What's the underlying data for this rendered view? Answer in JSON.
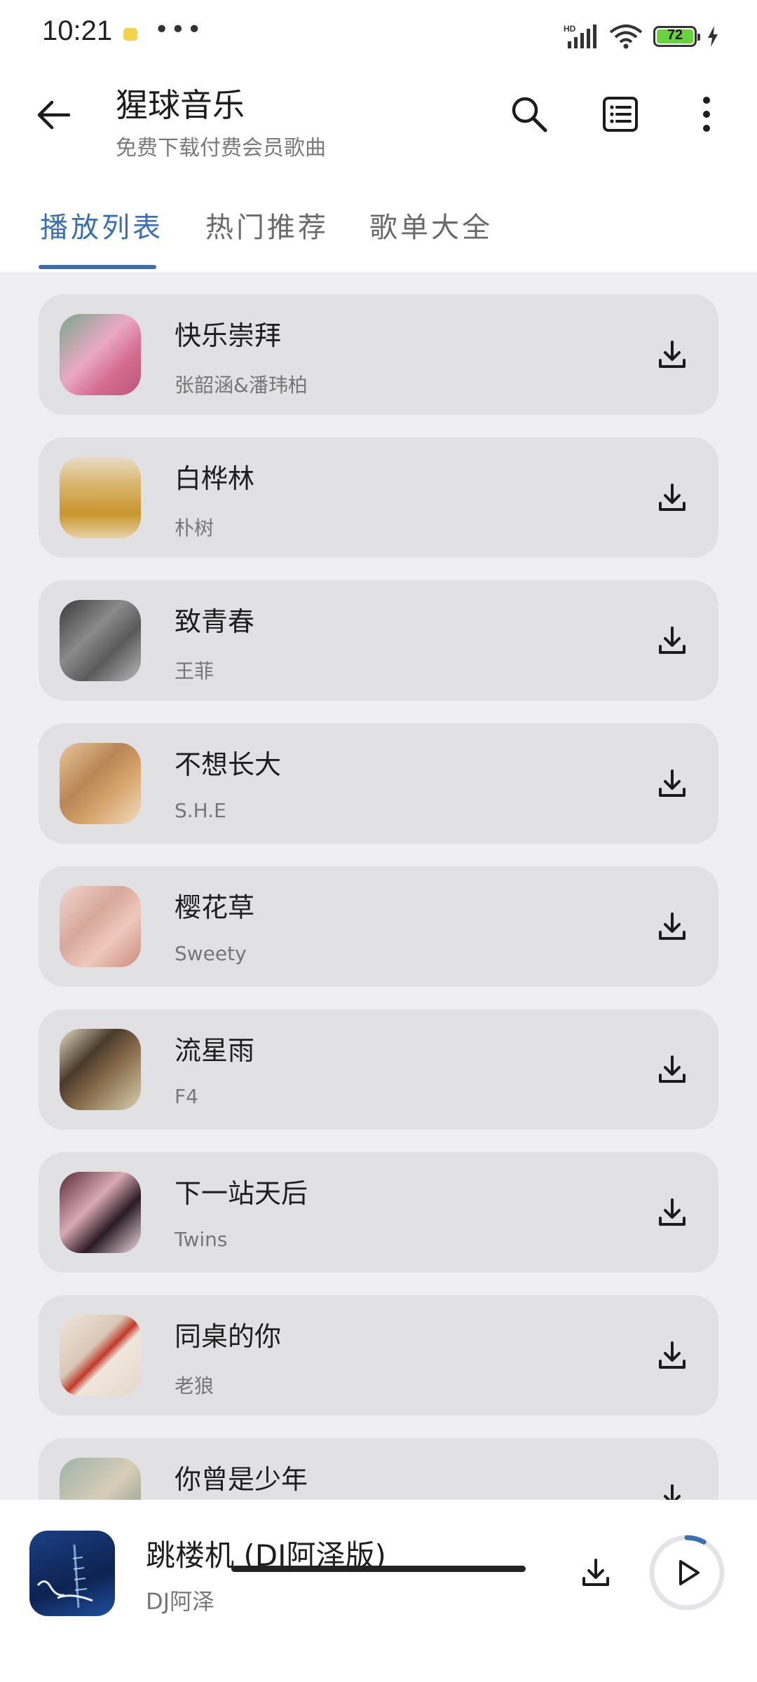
{
  "status_bar": {
    "time": "10:21",
    "battery": "72",
    "battery_color": "#6ad23e"
  },
  "app_bar": {
    "title": "猩球音乐",
    "subtitle": "免费下载付费会员歌曲",
    "icons": [
      "back-arrow-icon",
      "search-icon",
      "list-icon",
      "more-vertical-icon"
    ]
  },
  "tabs": [
    {
      "label": "播放列表",
      "active": true
    },
    {
      "label": "热门推荐",
      "active": false
    },
    {
      "label": "歌单大全",
      "active": false
    }
  ],
  "accent_color": "#3a6fb0",
  "songs": [
    {
      "title": "快乐崇拜",
      "artist": "张韶涵&潘玮柏"
    },
    {
      "title": "白桦林",
      "artist": "朴树"
    },
    {
      "title": "致青春",
      "artist": "王菲"
    },
    {
      "title": "不想长大",
      "artist": "S.H.E"
    },
    {
      "title": "樱花草",
      "artist": "Sweety"
    },
    {
      "title": "流星雨",
      "artist": "F4"
    },
    {
      "title": "下一站天后",
      "artist": "Twins"
    },
    {
      "title": "同桌的你",
      "artist": "老狼"
    },
    {
      "title": "你曾是少年",
      "artist": ""
    }
  ],
  "now_playing": {
    "title": "跳楼机 (DJ阿泽版)",
    "artist": "DJ阿泽",
    "progress": 0.08
  }
}
